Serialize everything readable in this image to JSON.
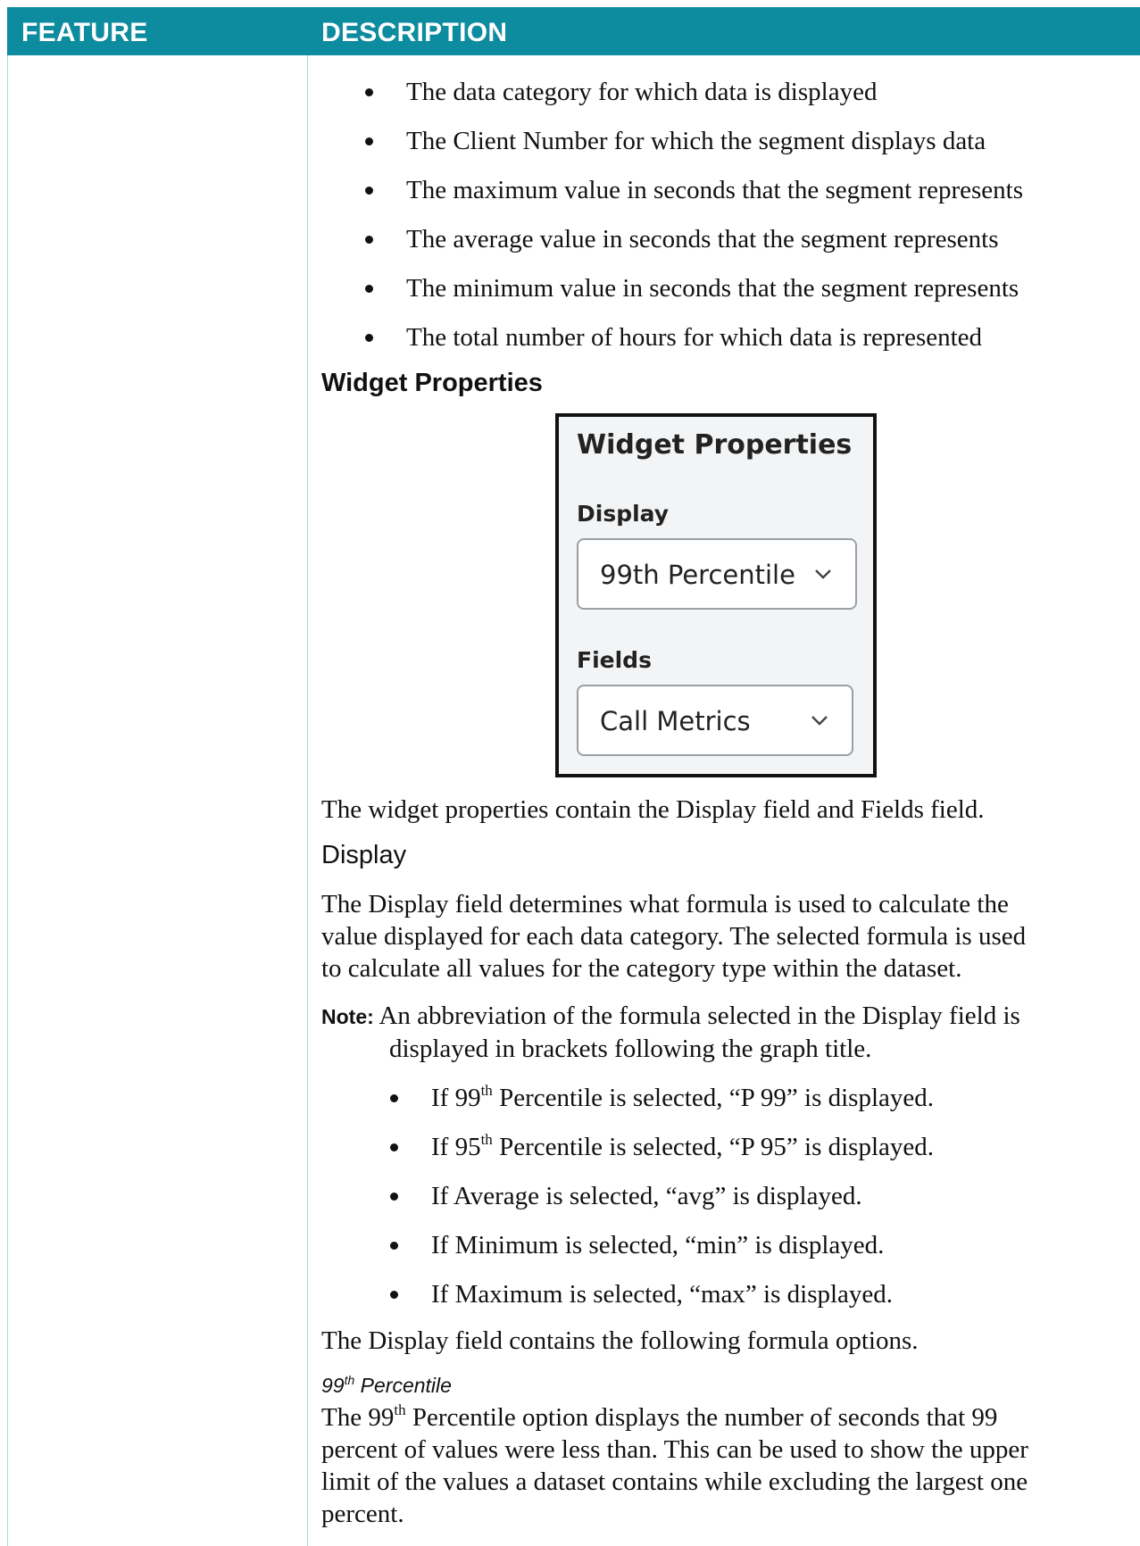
{
  "header": {
    "col1": "FEATURE",
    "col2": "DESCRIPTION"
  },
  "bullets_top": [
    "The data category for which data is displayed",
    "The Client Number for which the segment displays data",
    "The maximum value in seconds that the segment represents",
    "The average value in seconds that the segment represents",
    "The minimum value in seconds that the segment represents",
    "The total number of hours for which data is represented"
  ],
  "section_heading": "Widget Properties",
  "widget": {
    "title": "Widget Properties",
    "display_label": "Display",
    "display_value": "99th Percentile",
    "fields_label": "Fields",
    "fields_value": "Call Metrics",
    "chevron_icon": "chevron-down-icon"
  },
  "intro_para": "The widget properties contain the Display field and Fields field.",
  "display_heading": "Display",
  "display_para_lines": [
    "The Display field determines what formula is used to calculate the",
    "value displayed for each data category. The selected formula is used",
    "to calculate all values for the category type within the dataset."
  ],
  "note": {
    "label": "Note:",
    "line1": "An abbreviation of the formula selected in the Display field is",
    "line2": "displayed in brackets following the graph title."
  },
  "note_bullets": [
    {
      "pre": "If 99",
      "sup": "th",
      "post": " Percentile is selected, “P 99” is displayed."
    },
    {
      "pre": "If 95",
      "sup": "th",
      "post": " Percentile is selected, “P 95” is displayed."
    },
    {
      "pre": "If Average is selected, “avg” is displayed.",
      "sup": "",
      "post": ""
    },
    {
      "pre": "If Minimum is selected, “min” is displayed.",
      "sup": "",
      "post": ""
    },
    {
      "pre": "If Maximum is selected, “max” is displayed.",
      "sup": "",
      "post": ""
    }
  ],
  "options_para": "The Display field contains the following formula options.",
  "p99_heading": {
    "pre": "99",
    "sup": "th",
    "post": " Percentile"
  },
  "p99_para": {
    "l1_pre": "The 99",
    "l1_sup": "th",
    "l1_post": " Percentile option displays the number of seconds that 99",
    "l2": "percent of values were less than. This can be used to show the upper",
    "l3": "limit of the values a dataset contains while excluding the largest one",
    "l4": "percent."
  }
}
